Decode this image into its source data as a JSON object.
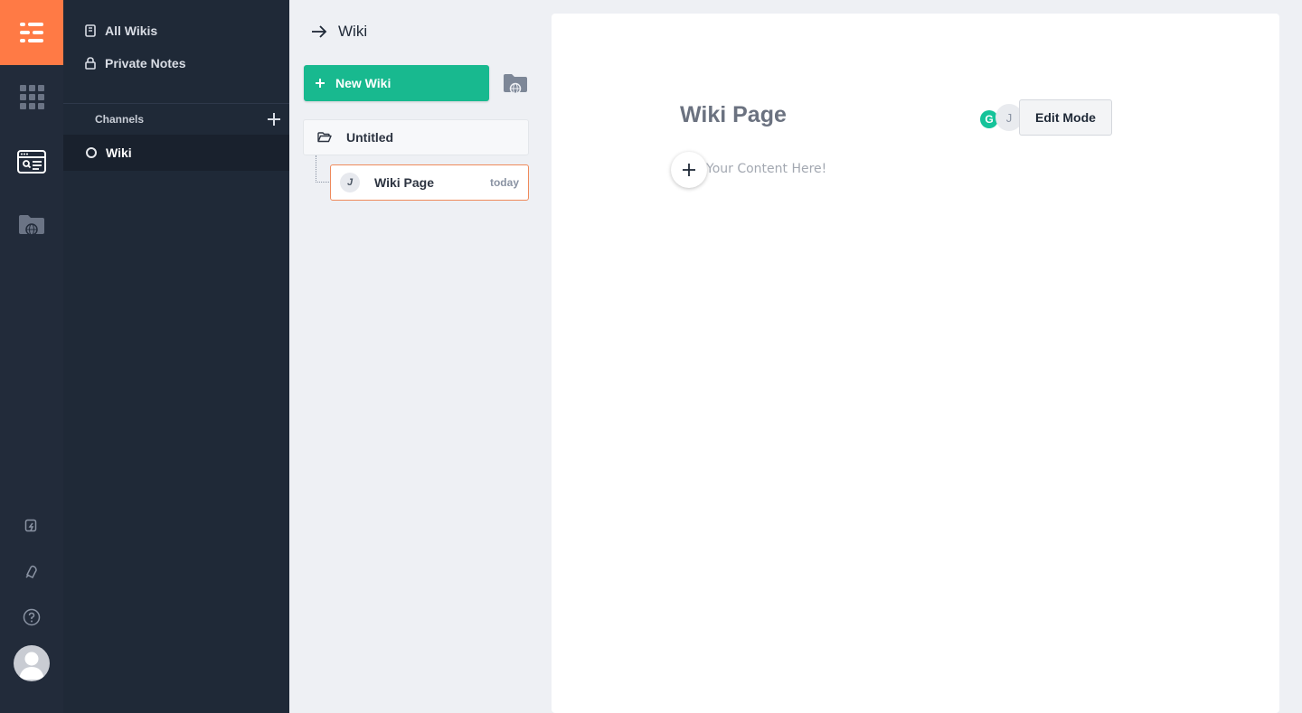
{
  "sidebar": {
    "items": [
      {
        "label": "All Wikis",
        "icon": "book-icon"
      },
      {
        "label": "Private Notes",
        "icon": "lock-icon"
      }
    ],
    "channels_heading": "Channels",
    "channels": [
      {
        "label": "Wiki"
      }
    ]
  },
  "middle": {
    "header": "Wiki",
    "new_wiki_label": "New Wiki",
    "folder": {
      "label": "Untitled"
    },
    "pages": [
      {
        "author_initial": "J",
        "title": "Wiki Page",
        "date": "today"
      }
    ]
  },
  "editor": {
    "title": "Wiki Page",
    "author_initial": "J",
    "grammarly_glyph": "G",
    "edit_mode_label": "Edit Mode",
    "content_placeholder": "Your Content Here!"
  },
  "colors": {
    "accent": "#ff7a45",
    "primary_button": "#18b98f",
    "rail": "#222b3a",
    "sidebar": "#1f2937"
  }
}
